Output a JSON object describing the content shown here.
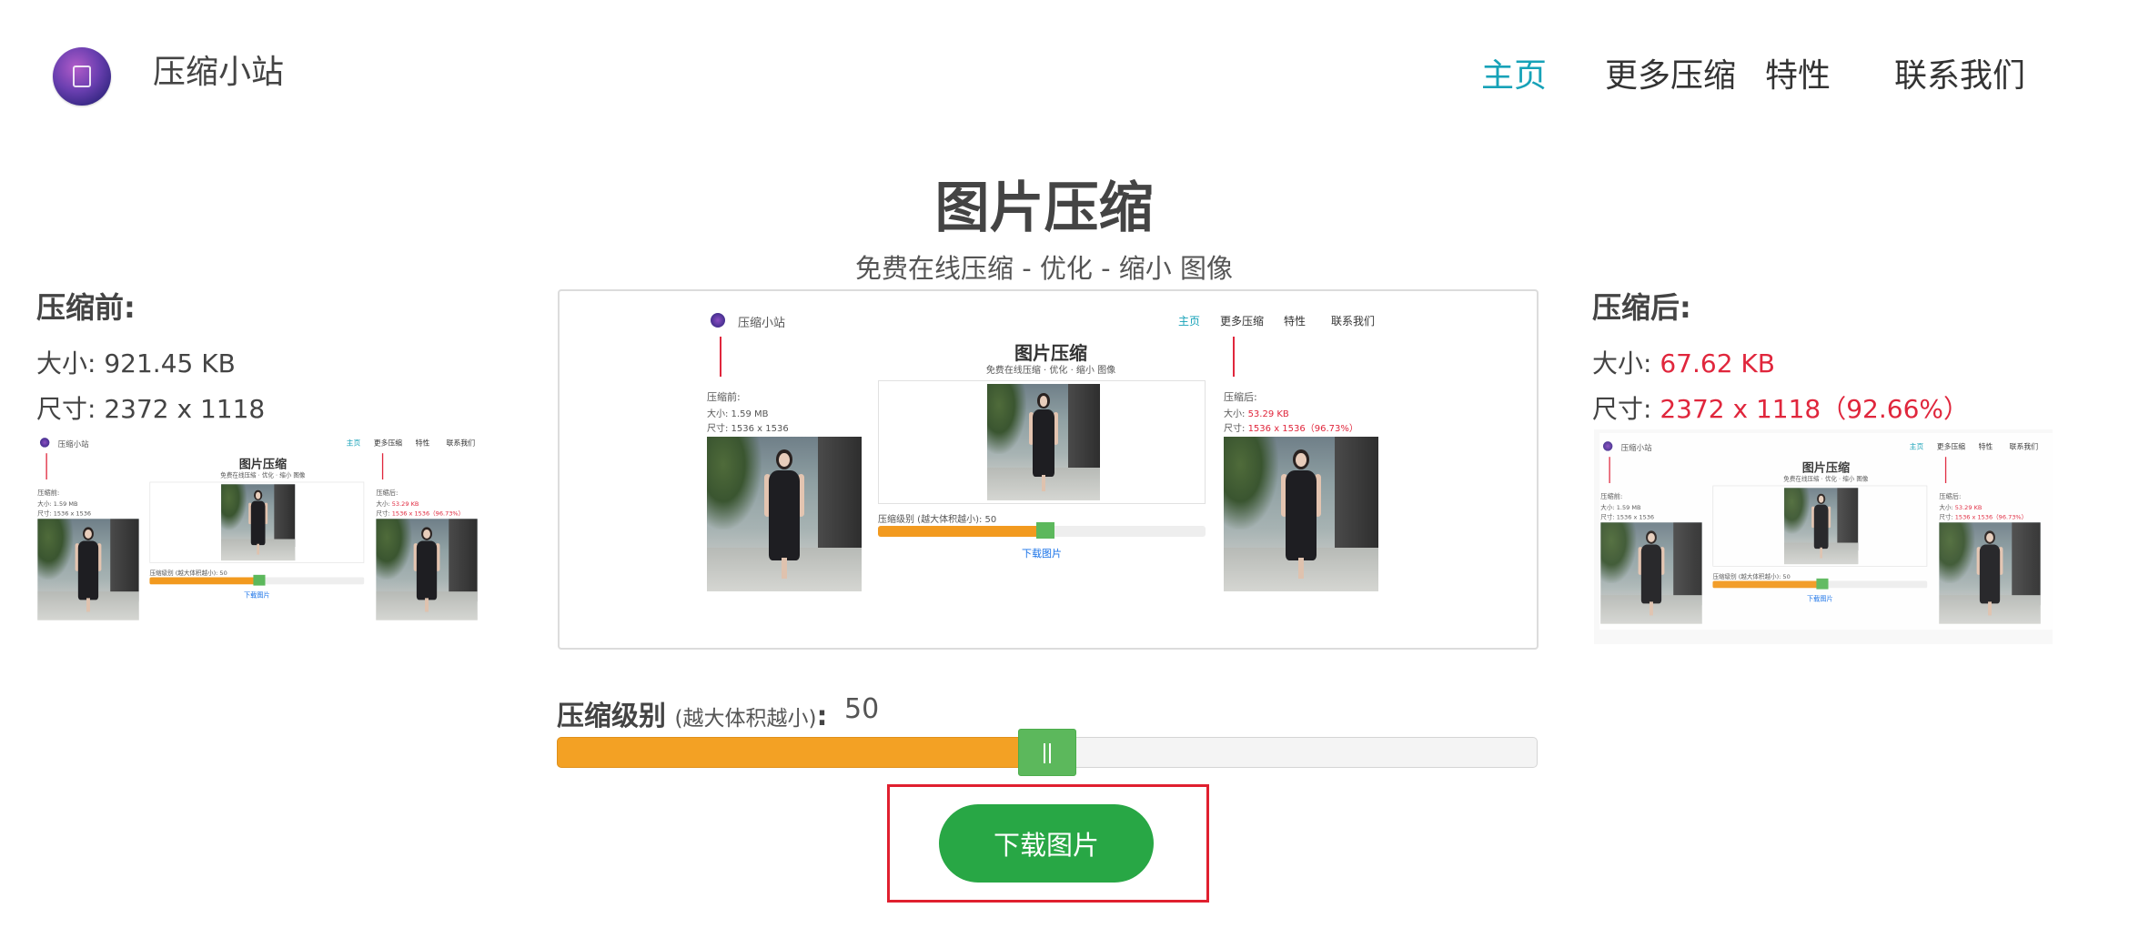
{
  "header": {
    "brand": "压缩小站",
    "nav": [
      {
        "label": "主页",
        "active": true
      },
      {
        "label": "更多压缩",
        "active": false
      },
      {
        "label": "特性",
        "active": false
      },
      {
        "label": "联系我们",
        "active": false
      }
    ]
  },
  "main": {
    "title": "图片压缩",
    "subtitle": "免费在线压缩 - 优化 - 缩小 图像"
  },
  "before": {
    "heading": "压缩前:",
    "size_label": "大小: ",
    "size_value": "921.45 KB",
    "dim_label": "尺寸: ",
    "dim_value": "2372 x 1118"
  },
  "after": {
    "heading": "压缩后:",
    "size_label": "大小: ",
    "size_value": "67.62 KB",
    "dim_label": "尺寸: ",
    "dim_value": "2372 x 1118（92.66%）"
  },
  "compression": {
    "label": "压缩级别",
    "hint": "(越大体积越小)",
    "colon": ":",
    "value": "50",
    "level_fraction": 0.5
  },
  "download": {
    "label": "下载图片"
  },
  "preview_mini": {
    "brand": "压缩小站",
    "nav": [
      "主页",
      "更多压缩",
      "特性",
      "联系我们"
    ],
    "title": "图片压缩",
    "subtitle": "免费在线压缩 · 优化 · 缩小 图像",
    "before_head": "压缩前:",
    "before_size": "大小: 1.59 MB",
    "before_dim": "尺寸: 1536 x 1536",
    "after_head": "压缩后:",
    "after_size_label": "大小: ",
    "after_size_value": "53.29 KB",
    "after_dim_label": "尺寸: ",
    "after_dim_value": "1536 x 1536（96.73%）",
    "level": "压缩级别 (越大体积越小):  50",
    "download": "下载图片"
  },
  "colors": {
    "accent": "#17a2b8",
    "highlight_red": "#e0263c",
    "slider_fill": "#f3a124",
    "slider_thumb": "#5cb85c",
    "download_button": "#28a745",
    "focus_border": "#e0202f"
  },
  "icons": {
    "logo": "logo-icon",
    "thumb_grip": "slider-grip-icon"
  }
}
